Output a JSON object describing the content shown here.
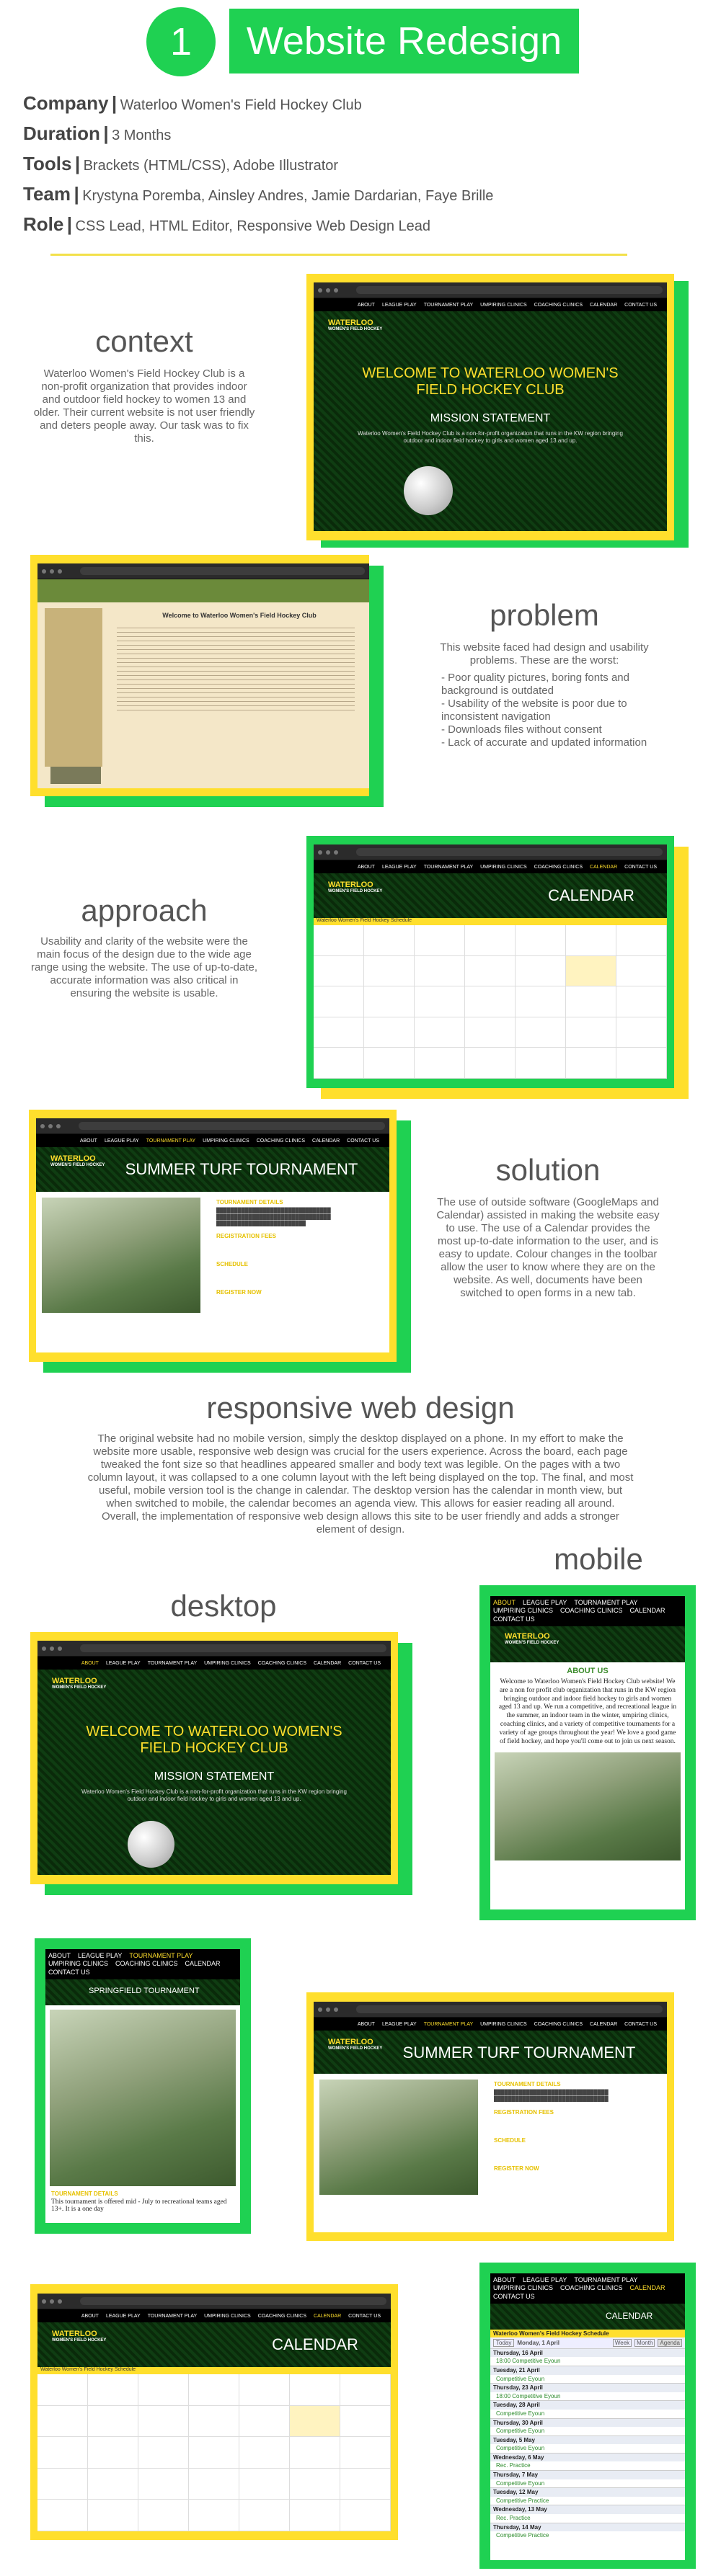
{
  "header": {
    "number": "1",
    "title": "Website Redesign"
  },
  "meta": [
    {
      "label": "Company",
      "value": "Waterloo Women's Field Hockey Club"
    },
    {
      "label": "Duration",
      "value": "3 Months"
    },
    {
      "label": "Tools",
      "value": "Brackets (HTML/CSS), Adobe Illustrator"
    },
    {
      "label": "Team",
      "value": "Krystyna Poremba, Ainsley Andres, Jamie Dardarian, Faye Brille"
    },
    {
      "label": "Role",
      "value": "CSS Lead, HTML Editor, Responsive Web Design Lead"
    }
  ],
  "context": {
    "title": "context",
    "text": "Waterloo Women's Field Hockey Club is a non-profit organization that provides indoor and outdoor field hockey to women 13 and older. Their current website is not user friendly and deters people away. Our task was to fix this."
  },
  "problem": {
    "title": "problem",
    "intro": "This website faced had design and usability problems. These are the worst:",
    "items": [
      "- Poor quality pictures, boring fonts and background is outdated",
      "- Usability of the website is poor due to inconsistent navigation",
      "- Downloads files without consent",
      "- Lack of accurate and updated information"
    ]
  },
  "approach": {
    "title": "approach",
    "text": "Usability and clarity of the website were the main focus of the design due to the wide age range using the website.  The use of up-to-date, accurate information was also critical in ensuring the website is usable."
  },
  "solution": {
    "title": "solution",
    "text": "The use of outside software (GoogleMaps and Calendar) assisted in making the website easy to use. The use of a Calendar provides the most up-to-date information to the user, and is easy to update. Colour changes in the toolbar allow the user to know where they are on the website. As well, documents have been switched to open forms in a new tab."
  },
  "responsive": {
    "title": "responsive web design",
    "text": "The original website had no mobile version, simply the desktop displayed on a phone. In my effort to make the website more usable, responsive web design was crucial for the users experience. Across the board, each page tweaked the font size so that headlines appeared smaller and body text was legible. On the pages with a two column layout, it was collapsed to a one column layout with the left being displayed on the top. The final, and most useful, mobile version tool is the change in calendar. The desktop version has the calendar in month view, but when switched to mobile, the calendar becomes an agenda view. This allows for easier reading all around. Overall, the implementation of responsive web design allows this site to be user friendly and adds a stronger element of design."
  },
  "labels": {
    "mobile": "mobile",
    "desktop": "desktop"
  },
  "site": {
    "nav": [
      "ABOUT",
      "LEAGUE PLAY",
      "TOURNAMENT PLAY",
      "UMPIRING CLINICS",
      "COACHING CLINICS",
      "CALENDAR",
      "CONTACT US"
    ],
    "logo_line1": "WATERLOO",
    "logo_line2": "WOMEN'S FIELD HOCKEY",
    "welcome": "WELCOME TO WATERLOO WOMEN'S FIELD HOCKEY CLUB",
    "mission": "MISSION STATEMENT",
    "mission_text": "Waterloo Women's Field Hockey Club is a non-for-profit organization that runs in the KW region bringing outdoor and indoor field hockey to girls and women aged 13 and up.",
    "calendar": "CALENDAR",
    "summer": "SUMMER TURF TOURNAMENT",
    "springfield": "SPRINGFIELD TOURNAMENT",
    "about": "ABOUT US",
    "about_text": "Welcome to Waterloo Women's Field Hockey Club website! We are a non for profit club organization that runs in the KW region bringing outdoor and indoor field hockey to girls and women aged 13 and up. We run a competitive, and recreational league in the summer, an indoor team in the winter, umpiring clinics, coaching clinics, and a variety of competitive tournaments for a variety of age groups throughout the year! We love a good game of field hockey, and hope you'll come out to join us next season.",
    "t_details": "TOURNAMENT DETAILS",
    "t_details_text": "This tournament is offered mid - July to recreational teams aged 13+. It is a one day",
    "reg": "REGISTRATION FEES",
    "schedule": "SCHEDULE",
    "register": "REGISTER NOW",
    "old_title": "Welcome to Waterloo Women's Field Hockey Club",
    "cal_header": "Waterloo Women's Field Hockey Schedule",
    "agenda": [
      {
        "day": "Thursday, 16 April",
        "items": [
          "18:00 Competitive Eyoun"
        ]
      },
      {
        "day": "Tuesday, 21 April",
        "items": [
          "Competitive Eyoun"
        ]
      },
      {
        "day": "Thursday, 23 April",
        "items": [
          "18:00 Competitive Eyoun"
        ]
      },
      {
        "day": "Tuesday, 28 April",
        "items": [
          "Competitive Eyoun"
        ]
      },
      {
        "day": "Thursday, 30 April",
        "items": [
          "Competitive Eyoun"
        ]
      },
      {
        "day": "Tuesday, 5 May",
        "items": [
          "Competitive Eyoun"
        ]
      },
      {
        "day": "Wednesday, 6 May",
        "items": [
          "Rec. Practice"
        ]
      },
      {
        "day": "Thursday, 7 May",
        "items": [
          "Competitive Eyoun"
        ]
      },
      {
        "day": "Tuesday, 12 May",
        "items": [
          "Competitive Practice"
        ]
      },
      {
        "day": "Wednesday, 13 May",
        "items": [
          "Rec. Practice"
        ]
      },
      {
        "day": "Thursday, 14 May",
        "items": [
          "Competitive Practice"
        ]
      }
    ],
    "agenda_tabs": [
      "Week",
      "Month",
      "Agenda"
    ],
    "today": "Today",
    "month_label": "Monday, 1 April"
  }
}
